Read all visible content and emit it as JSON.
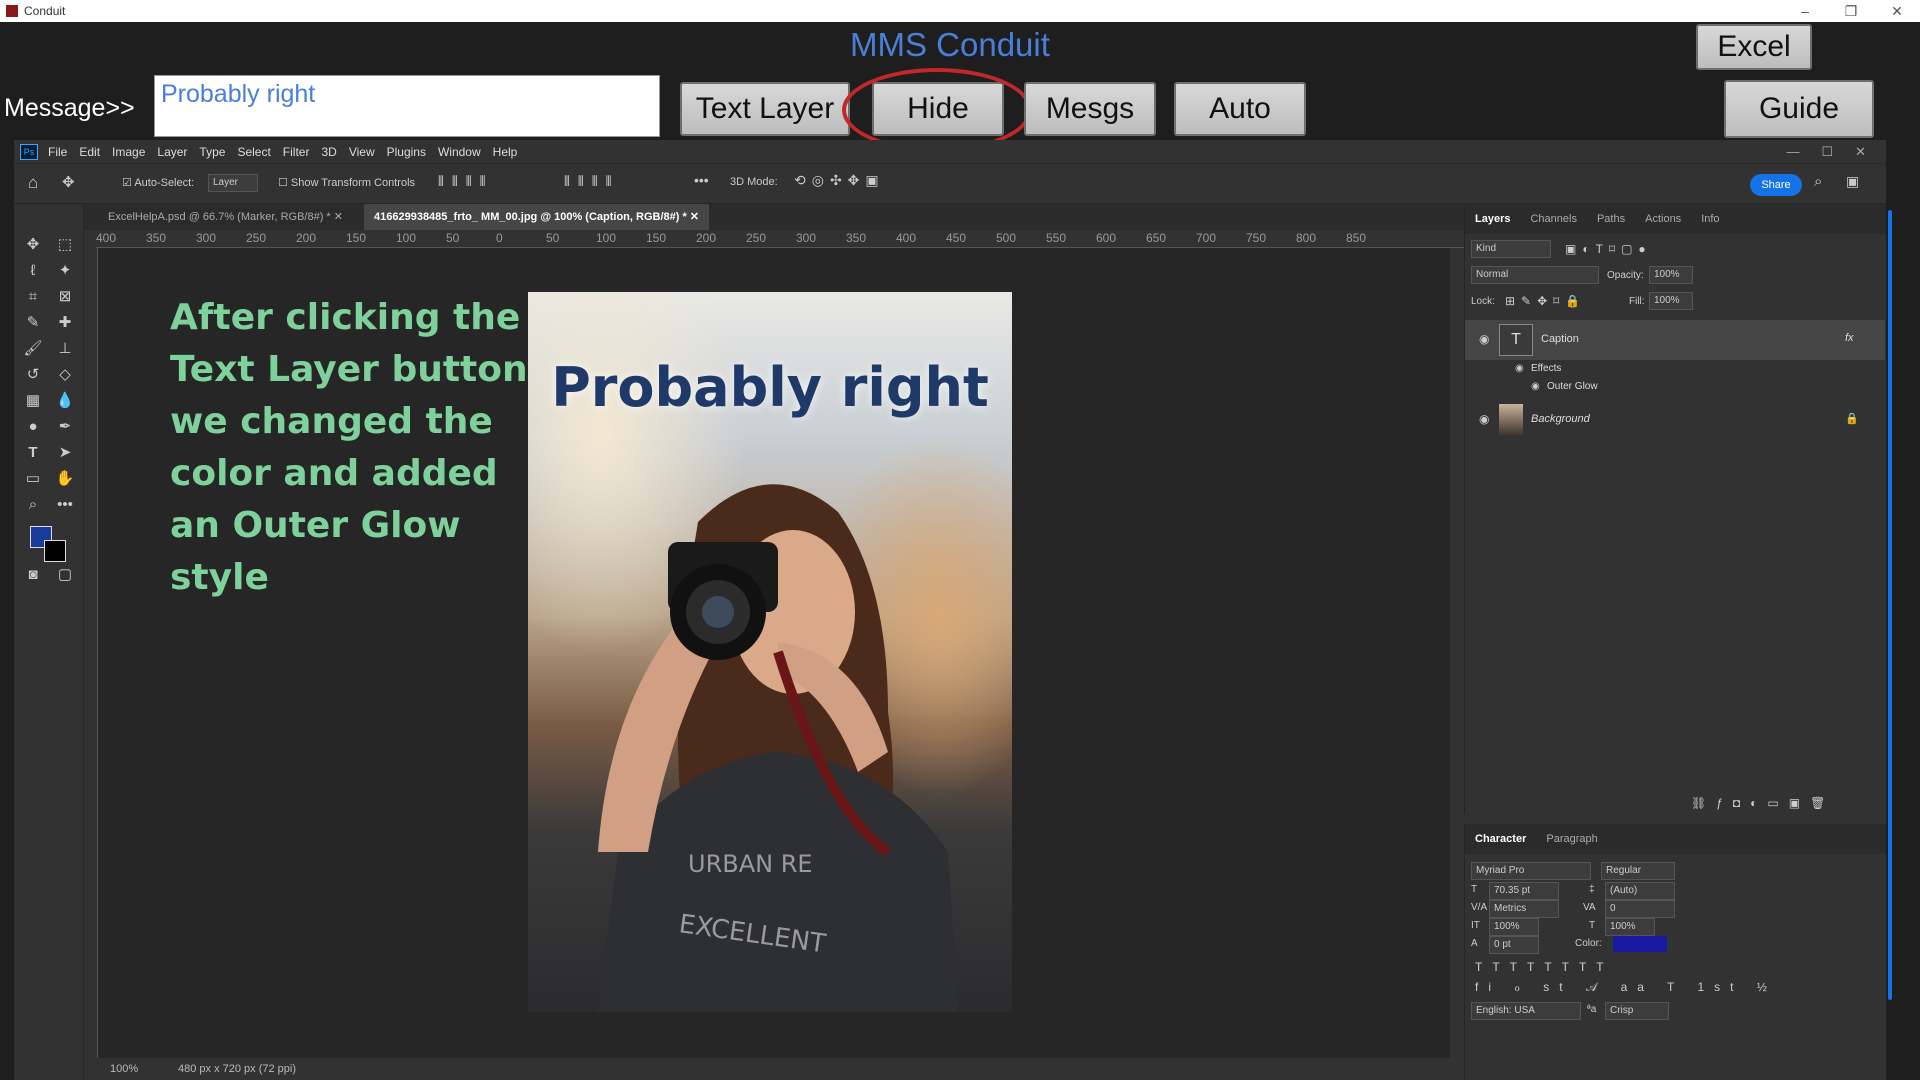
{
  "window": {
    "title": "Conduit",
    "controls": [
      "–",
      "❐",
      "✕"
    ]
  },
  "conduit": {
    "title": "MMS Conduit",
    "message_label": "Message>>",
    "message_value": "Probably right",
    "buttons": {
      "text_layer": "Text Layer",
      "hide": "Hide",
      "mesgs": "Mesgs",
      "auto": "Auto",
      "excel": "Excel",
      "guide": "Guide"
    }
  },
  "photoshop": {
    "menu": [
      "File",
      "Edit",
      "Image",
      "Layer",
      "Type",
      "Select",
      "Filter",
      "3D",
      "View",
      "Plugins",
      "Window",
      "Help"
    ],
    "options": {
      "auto_select": "Auto-Select:",
      "layer_select": "Layer",
      "show_transform": "Show Transform Controls",
      "mode_3d": "3D Mode:",
      "share": "Share"
    },
    "tabs": [
      {
        "label": "ExcelHelpA.psd @ 66.7% (Marker, RGB/8#) *"
      },
      {
        "label": "416629938485_frto_                                   MM_00.jpg @ 100% (Caption, RGB/8#) *"
      }
    ],
    "ruler_ticks": [
      "400",
      "350",
      "300",
      "250",
      "200",
      "150",
      "100",
      "50",
      "0",
      "50",
      "100",
      "150",
      "200",
      "250",
      "300",
      "350",
      "400",
      "450",
      "500",
      "550",
      "600",
      "650",
      "700",
      "750",
      "800",
      "850"
    ],
    "canvas": {
      "caption_text": "Probably right",
      "annotation": [
        "After clicking the",
        "Text Layer button",
        "we changed the",
        "color and added",
        "an Outer Glow",
        "style"
      ]
    },
    "status": {
      "zoom": "100%",
      "doc_info": "480 px x 720 px (72 ppi)"
    },
    "layers_panel": {
      "tabs": [
        "Layers",
        "Channels",
        "Paths",
        "Actions",
        "Info"
      ],
      "kind": "Kind",
      "blend_mode": "Normal",
      "opacity_label": "Opacity:",
      "opacity": "100%",
      "lock_label": "Lock:",
      "fill_label": "Fill:",
      "fill": "100%",
      "layers": [
        {
          "name": "Caption",
          "fx": "fx",
          "effects_label": "Effects",
          "effect": "Outer Glow"
        },
        {
          "name": "Background"
        }
      ]
    },
    "character_panel": {
      "tabs": [
        "Character",
        "Paragraph"
      ],
      "font_family": "Myriad Pro",
      "font_style": "Regular",
      "font_size": "70.35 pt",
      "leading": "(Auto)",
      "kerning": "Metrics",
      "tracking": "0",
      "vertical_scale": "100%",
      "horizontal_scale": "100%",
      "baseline_shift": "0 pt",
      "color_label": "Color:",
      "color": "#1a1aa0",
      "language": "English: USA",
      "aa_icon": "ªa",
      "antialias": "Crisp"
    }
  },
  "colors": {
    "conduit_title": "#4a7fd8",
    "annotation": "#7ed19a",
    "caption": "#1f3a68",
    "hide_ring": "#c0282a",
    "fg_swatch": "#1a3a9c"
  }
}
